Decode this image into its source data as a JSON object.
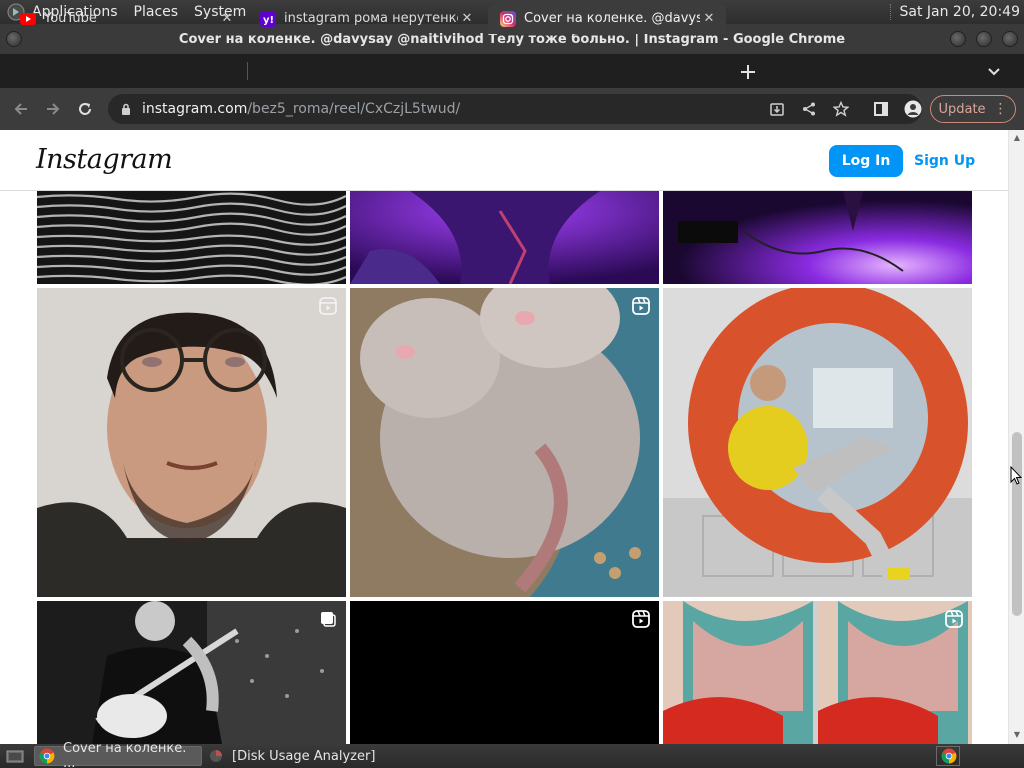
{
  "top_panel": {
    "menus": [
      "Applications",
      "Places",
      "System"
    ],
    "clock": "Sat Jan 20, 20:49"
  },
  "window": {
    "title": "Cover на коленке. @davysay @naitivihod Телу тоже больно. | Instagram - Google Chrome"
  },
  "tabs": [
    {
      "title": "YouTube",
      "icon": "youtube-icon",
      "active": false
    },
    {
      "title": "instagram рома нерутенко -",
      "icon": "yahoo-icon",
      "active": false
    },
    {
      "title": "Cover на коленке. @davysay",
      "icon": "instagram-icon",
      "active": true
    }
  ],
  "address_bar": {
    "host": "instagram.com",
    "path": "/bez5_roma/reel/CxCzjL5twud/"
  },
  "toolbar": {
    "update_label": "Update"
  },
  "instagram": {
    "logo": "Instagram",
    "login_label": "Log In",
    "signup_label": "Sign Up"
  },
  "taskbar": {
    "tasks": [
      {
        "label": "Cover на коленке. ...",
        "icon": "chrome-icon",
        "active": true
      },
      {
        "label": "[Disk Usage Analyzer]",
        "icon": "disk-usage-icon",
        "active": false
      }
    ]
  },
  "colors": {
    "instagram_blue": "#0095f6",
    "chrome_dark": "#3c3c3c",
    "update_accent": "#c98a7a"
  }
}
